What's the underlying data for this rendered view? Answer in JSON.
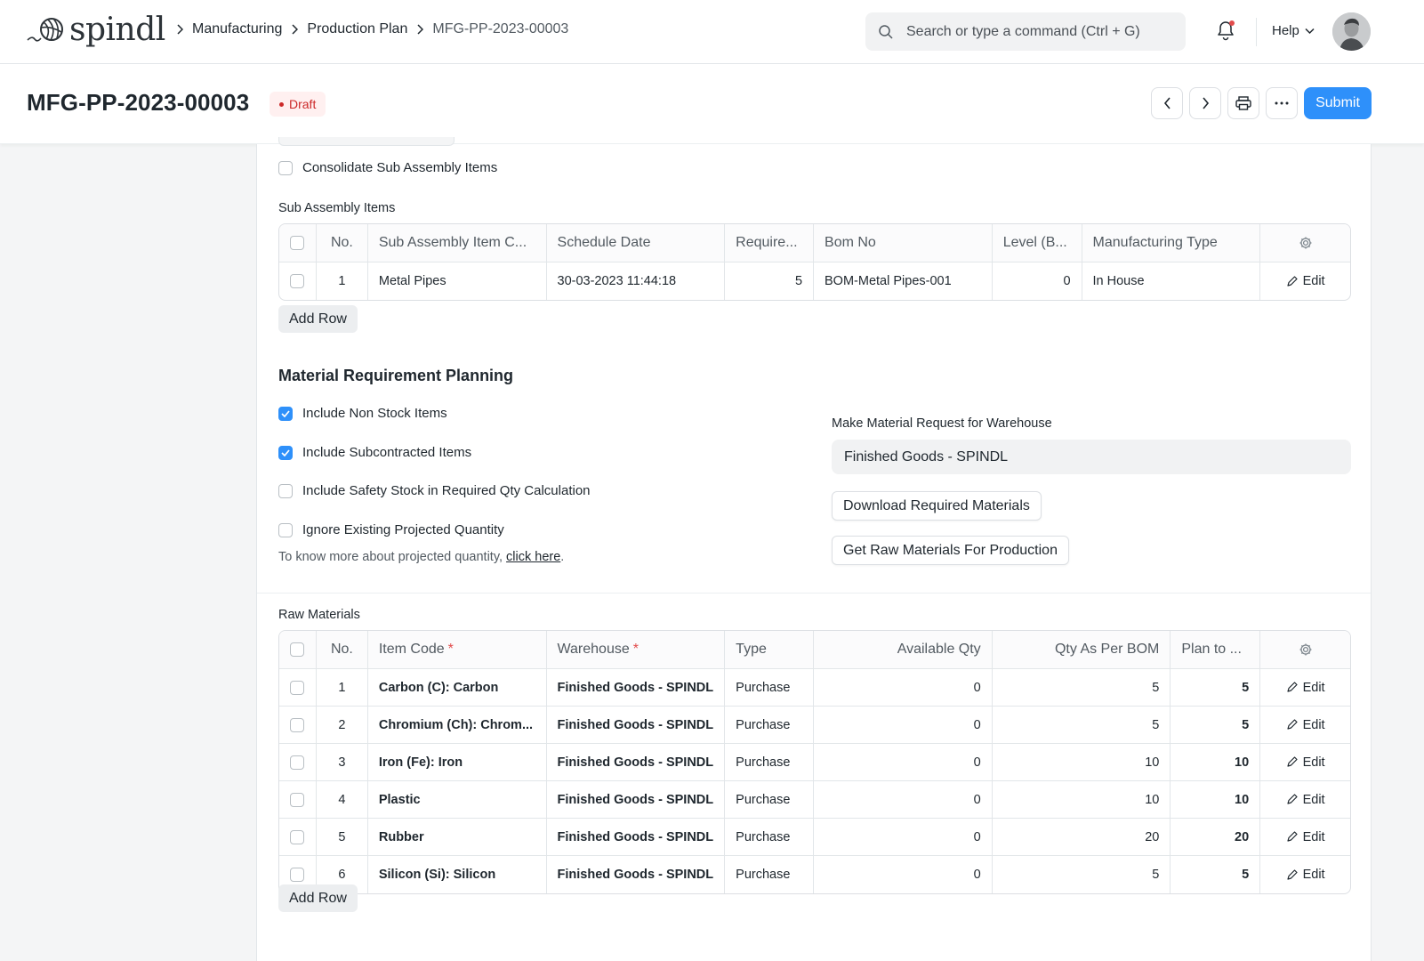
{
  "app": {
    "logo_text": "spindl"
  },
  "breadcrumbs": [
    "Manufacturing",
    "Production Plan",
    "MFG-PP-2023-00003"
  ],
  "search": {
    "placeholder": "Search or type a command (Ctrl + G)"
  },
  "nav": {
    "help_label": "Help"
  },
  "doc": {
    "title": "MFG-PP-2023-00003",
    "status": "Draft",
    "submit_label": "Submit"
  },
  "consolidate": {
    "label": "Consolidate Sub Assembly Items",
    "checked": false
  },
  "sub_assembly": {
    "label": "Sub Assembly Items",
    "columns": [
      "No.",
      "Sub Assembly Item C...",
      "Schedule Date",
      "Require...",
      "Bom No",
      "Level (B...",
      "Manufacturing Type"
    ],
    "rows": [
      {
        "no": "1",
        "item": "Metal Pipes",
        "date": "30-03-2023 11:44:18",
        "required": "5",
        "bom": "BOM-Metal Pipes-001",
        "level": "0",
        "mtype": "In House"
      }
    ],
    "add_row": "Add Row",
    "edit_label": "Edit"
  },
  "mrp": {
    "title": "Material Requirement Planning",
    "options": [
      {
        "label": "Include Non Stock Items",
        "checked": true
      },
      {
        "label": "Include Subcontracted Items",
        "checked": true
      },
      {
        "label": "Include Safety Stock in Required Qty Calculation",
        "checked": false
      },
      {
        "label": "Ignore Existing Projected Quantity",
        "checked": false
      }
    ],
    "hint_prefix": "To know more about projected quantity, ",
    "hint_link": "click here",
    "hint_suffix": ".",
    "warehouse_label": "Make Material Request for Warehouse",
    "warehouse_value": "Finished Goods - SPINDL",
    "download_btn": "Download Required Materials",
    "get_raw_btn": "Get Raw Materials For Production"
  },
  "raw_materials": {
    "label": "Raw Materials",
    "columns": [
      "No.",
      "Item Code",
      "Warehouse",
      "Type",
      "Available Qty",
      "Qty As Per BOM",
      "Plan to ..."
    ],
    "rows": [
      {
        "no": "1",
        "item": "Carbon (C): Carbon",
        "warehouse": "Finished Goods - SPINDL",
        "type": "Purchase",
        "available": "0",
        "bom_qty": "5",
        "plan": "5"
      },
      {
        "no": "2",
        "item": "Chromium (Ch): Chrom...",
        "warehouse": "Finished Goods - SPINDL",
        "type": "Purchase",
        "available": "0",
        "bom_qty": "5",
        "plan": "5"
      },
      {
        "no": "3",
        "item": "Iron (Fe): Iron",
        "warehouse": "Finished Goods - SPINDL",
        "type": "Purchase",
        "available": "0",
        "bom_qty": "10",
        "plan": "10"
      },
      {
        "no": "4",
        "item": "Plastic",
        "warehouse": "Finished Goods - SPINDL",
        "type": "Purchase",
        "available": "0",
        "bom_qty": "10",
        "plan": "10"
      },
      {
        "no": "5",
        "item": "Rubber",
        "warehouse": "Finished Goods - SPINDL",
        "type": "Purchase",
        "available": "0",
        "bom_qty": "20",
        "plan": "20"
      },
      {
        "no": "6",
        "item": "Silicon (Si): Silicon",
        "warehouse": "Finished Goods - SPINDL",
        "type": "Purchase",
        "available": "0",
        "bom_qty": "5",
        "plan": "5"
      }
    ],
    "add_row": "Add Row",
    "edit_label": "Edit"
  },
  "colors": {
    "primary": "#2e90fa",
    "draft_text": "#cc2929",
    "draft_bg": "#fff0f0"
  }
}
